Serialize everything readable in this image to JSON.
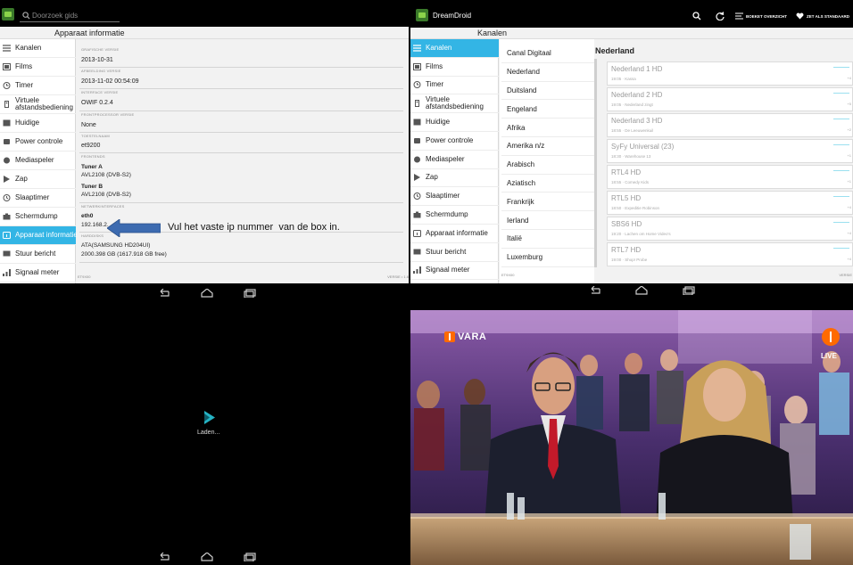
{
  "left_panel": {
    "search_placeholder": "Doorzoek gids",
    "title": "Apparaat informatie",
    "sidebar": [
      {
        "label": "Kanalen",
        "icon": "list-icon"
      },
      {
        "label": "Films",
        "icon": "film-icon"
      },
      {
        "label": "Timer",
        "icon": "timer-icon"
      },
      {
        "label": "Virtuele afstandsbediening",
        "icon": "remote-icon"
      },
      {
        "label": "Huidige",
        "icon": "current-icon"
      },
      {
        "label": "Power controle",
        "icon": "power-icon"
      },
      {
        "label": "Mediaspeler",
        "icon": "media-icon"
      },
      {
        "label": "Zap",
        "icon": "play-icon"
      },
      {
        "label": "Slaaptimer",
        "icon": "clock-icon"
      },
      {
        "label": "Schermdump",
        "icon": "camera-icon"
      },
      {
        "label": "Apparaat informatie",
        "icon": "info-icon",
        "active": true
      },
      {
        "label": "Stuur bericht",
        "icon": "message-icon"
      },
      {
        "label": "Signaal meter",
        "icon": "signal-icon"
      }
    ],
    "info": [
      {
        "key": "Grafische versie",
        "lines": [
          "2013-10-31"
        ]
      },
      {
        "key": "Afbeelding versie",
        "lines": [
          "2013-11-02 00:54:09"
        ]
      },
      {
        "key": "Interface versie",
        "lines": [
          "OWIF 0.2.4"
        ]
      },
      {
        "key": "Frontprocessor versie",
        "lines": [
          "None"
        ]
      },
      {
        "key": "Toestelnaam",
        "lines": [
          "et9200"
        ]
      },
      {
        "key": "Frontends",
        "tuners": [
          {
            "name": "Tuner A",
            "value": "AVL2108 (DVB-S2)"
          },
          {
            "name": "Tuner B",
            "value": "AVL2108 (DVB-S2)"
          }
        ]
      },
      {
        "key": "Netwerkinterfaces",
        "iface": "eth0",
        "ip": "192.168.2."
      },
      {
        "key": "Harddisks",
        "disk": "ATA(SAMSUNG HD204UI)",
        "size": "2000.398 GB (1617.918 GB free)"
      }
    ],
    "footer_left": "ET9X00",
    "footer_right": "VERSIE • 1.6",
    "annotation": "Vul het vaste ip nummer  van de box in."
  },
  "loading": {
    "label": "Laden..."
  },
  "right_panel": {
    "app_name": "DreamDroid",
    "title": "Kanalen",
    "actions": {
      "bouquet": "BOEKET OVERZICHT",
      "set_default": "ZET ALS STANDAARD"
    },
    "sidebar": [
      {
        "label": "Kanalen",
        "icon": "list-icon",
        "active": true
      },
      {
        "label": "Films",
        "icon": "film-icon"
      },
      {
        "label": "Timer",
        "icon": "timer-icon"
      },
      {
        "label": "Virtuele afstandsbediening",
        "icon": "remote-icon"
      },
      {
        "label": "Huidige",
        "icon": "current-icon"
      },
      {
        "label": "Power controle",
        "icon": "power-icon"
      },
      {
        "label": "Mediaspeler",
        "icon": "media-icon"
      },
      {
        "label": "Zap",
        "icon": "play-icon"
      },
      {
        "label": "Slaaptimer",
        "icon": "clock-icon"
      },
      {
        "label": "Schermdump",
        "icon": "camera-icon"
      },
      {
        "label": "Apparaat informatie",
        "icon": "info-icon"
      },
      {
        "label": "Stuur bericht",
        "icon": "message-icon"
      },
      {
        "label": "Signaal meter",
        "icon": "signal-icon"
      }
    ],
    "providers": [
      "Canal Digitaal",
      "Nederland",
      "Duitsland",
      "Engeland",
      "Afrika",
      "Amerika n/z",
      "Arabisch",
      "Aziatisch",
      "Frankrijk",
      "Ierland",
      "Italië",
      "Luxemburg"
    ],
    "selected_provider": "Nederland",
    "services": [
      {
        "name": "Nederland 1 HD",
        "event": "19:05 · Kassa",
        "pct": "+4"
      },
      {
        "name": "Nederland 2 HD",
        "event": "19:05 · Nederland zingt",
        "pct": "+5"
      },
      {
        "name": "Nederland 3 HD",
        "event": "18:55 · De Leeuwenkuil",
        "pct": "+2"
      },
      {
        "name": "SyFy Universal (23)",
        "event": "18:30 · Warehouse 13",
        "pct": "+1"
      },
      {
        "name": "RTL4 HD",
        "event": "18:55 · Comedy Kids",
        "pct": "+1"
      },
      {
        "name": "RTL5 HD",
        "event": "18:50 · Expeditie Robinson",
        "pct": "+4"
      },
      {
        "name": "SBS6 HD",
        "event": "19:20 · Lachen om Home Video's",
        "pct": "+4"
      },
      {
        "name": "RTL7 HD",
        "event": "19:00 · Shop! Probe",
        "pct": "+4"
      }
    ],
    "footer_left": "ET9X00",
    "footer_right": "VERSIE"
  },
  "tv": {
    "channel_logo": "VARA",
    "live_label": "LIVE",
    "colors": {
      "npo_orange": "#ff6a00",
      "set_purple": "#4a2f6e"
    }
  },
  "colors": {
    "accent": "#33b5e5",
    "arrow": "#3d6bb0"
  }
}
